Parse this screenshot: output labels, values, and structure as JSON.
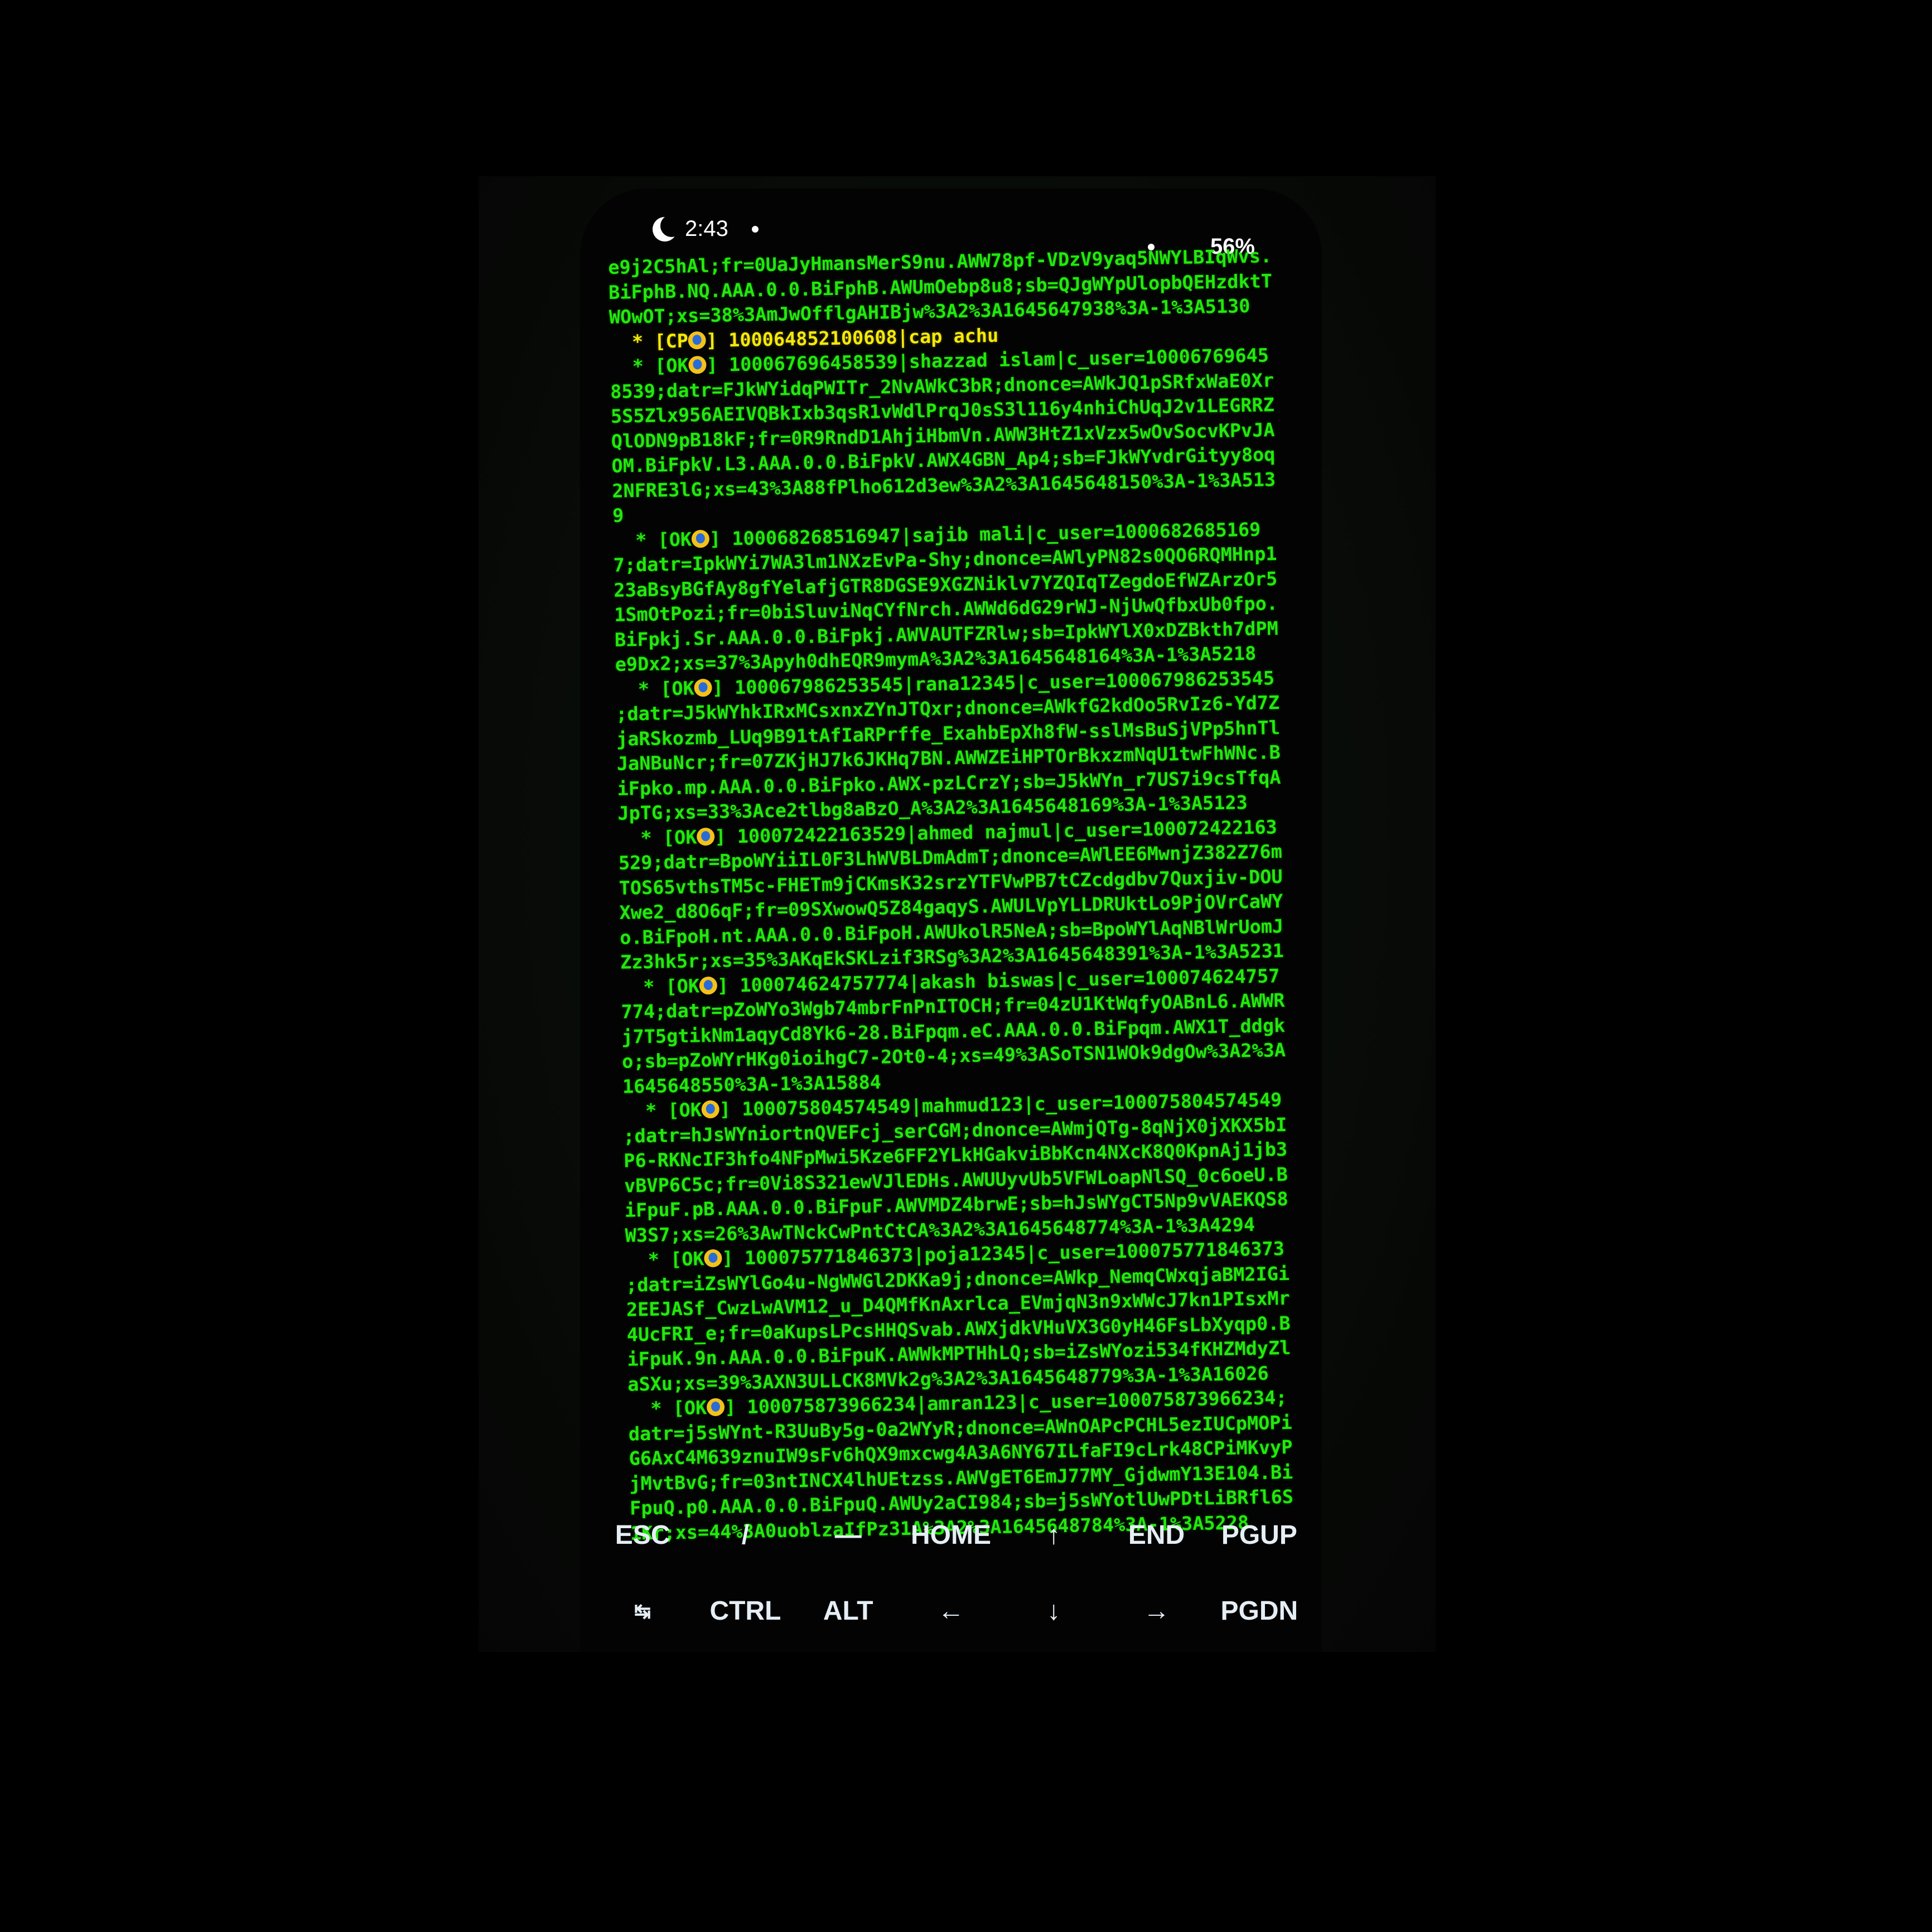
{
  "status_bar": {
    "time": "2:43",
    "battery": "56%"
  },
  "terminal": {
    "lines": [
      {
        "text": "e9j2C5hAl;fr=0UaJyHmansMerS9nu.AWW78pf-VDzV9yaq5NWYLBIqWvs."
      },
      {
        "text": "BiFphB.NQ.AAA.0.0.BiFphB.AWUmOebp8u8;sb=QJgWYpUlopbQEHzdktT"
      },
      {
        "text": "WOwOT;xs=38%3AmJwOfflgAHIBjw%3A2%3A1645647938%3A-1%3A5130"
      },
      {
        "prefix": "  * [CP",
        "suffix": "] ",
        "rest": "100064852100608|cap achu",
        "cp": true
      },
      {
        "prefix": "  * [OK",
        "suffix": "] ",
        "rest": "100067696458539|shazzad islam|c_user=10006769645"
      },
      {
        "text": "8539;datr=FJkWYidqPWITr_2NvAWkC3bR;dnonce=AWkJQ1pSRfxWaE0Xr"
      },
      {
        "text": "5S5Zlx956AEIVQBkIxb3qsR1vWdlPrqJ0sS3l116y4nhiChUqJ2v1LEGRRZ"
      },
      {
        "text": "QlODN9pB18kF;fr=0R9RndD1AhjiHbmVn.AWW3HtZ1xVzx5wOvSocvKPvJA"
      },
      {
        "text": "OM.BiFpkV.L3.AAA.0.0.BiFpkV.AWX4GBN_Ap4;sb=FJkWYvdrGityy8oq"
      },
      {
        "text": "2NFRE3lG;xs=43%3A88fPlho612d3ew%3A2%3A1645648150%3A-1%3A513"
      },
      {
        "text": "9"
      },
      {
        "prefix": "  * [OK",
        "suffix": "] ",
        "rest": "100068268516947|sajib mali|c_user=1000682685169"
      },
      {
        "text": "7;datr=IpkWYi7WA3lm1NXzEvPa-Shy;dnonce=AWlyPN82s0QO6RQMHnp1"
      },
      {
        "text": "23aBsyBGfAy8gfYelafjGTR8DGSE9XGZNiklv7YZQIqTZegdoEfWZArzOr5"
      },
      {
        "text": "1SmOtPozi;fr=0biSluviNqCYfNrch.AWWd6dG29rWJ-NjUwQfbxUb0fpo."
      },
      {
        "text": "BiFpkj.Sr.AAA.0.0.BiFpkj.AWVAUTFZRlw;sb=IpkWYlX0xDZBkth7dPM"
      },
      {
        "text": "e9Dx2;xs=37%3Apyh0dhEQR9mymA%3A2%3A1645648164%3A-1%3A5218"
      },
      {
        "prefix": "  * [OK",
        "suffix": "] ",
        "rest": "100067986253545|rana12345|c_user=100067986253545"
      },
      {
        "text": ";datr=J5kWYhkIRxMCsxnxZYnJTQxr;dnonce=AWkfG2kdOo5RvIz6-Yd7Z"
      },
      {
        "text": "jaRSkozmb_LUq9B91tAfIaRPrffe_ExahbEpXh8fW-sslMsBuSjVPp5hnTl"
      },
      {
        "text": "JaNBuNcr;fr=07ZKjHJ7k6JKHq7BN.AWWZEiHPTOrBkxzmNqU1twFhWNc.B"
      },
      {
        "text": "iFpko.mp.AAA.0.0.BiFpko.AWX-pzLCrzY;sb=J5kWYn_r7US7i9csTfqA"
      },
      {
        "text": "JpTG;xs=33%3Ace2tlbg8aBzO_A%3A2%3A1645648169%3A-1%3A5123"
      },
      {
        "prefix": "  * [OK",
        "suffix": "] ",
        "rest": "100072422163529|ahmed najmul|c_user=100072422163"
      },
      {
        "text": "529;datr=BpoWYiiIL0F3LhWVBLDmAdmT;dnonce=AWlEE6MwnjZ382Z76m"
      },
      {
        "text": "TOS65vthsTM5c-FHETm9jCKmsK32srzYTFVwPB7tCZcdgdbv7Quxjiv-DOU"
      },
      {
        "text": "Xwe2_d8O6qF;fr=09SXwowQ5Z84gaqyS.AWULVpYLLDRUktLo9PjOVrCaWY"
      },
      {
        "text": "o.BiFpoH.nt.AAA.0.0.BiFpoH.AWUkolR5NeA;sb=BpoWYlAqNBlWrUomJ"
      },
      {
        "text": "Zz3hk5r;xs=35%3AKqEkSKLzif3RSg%3A2%3A1645648391%3A-1%3A5231"
      },
      {
        "prefix": "  * [OK",
        "suffix": "] ",
        "rest": "100074624757774|akash biswas|c_user=100074624757"
      },
      {
        "text": "774;datr=pZoWYo3Wgb74mbrFnPnITOCH;fr=04zU1KtWqfyOABnL6.AWWR"
      },
      {
        "text": "j7T5gtikNm1aqyCd8Yk6-28.BiFpqm.eC.AAA.0.0.BiFpqm.AWX1T_ddgk"
      },
      {
        "text": "o;sb=pZoWYrHKg0ioihgC7-2Ot0-4;xs=49%3ASoTSN1WOk9dgOw%3A2%3A"
      },
      {
        "text": "1645648550%3A-1%3A15884"
      },
      {
        "prefix": "  * [OK",
        "suffix": "] ",
        "rest": "100075804574549|mahmud123|c_user=100075804574549"
      },
      {
        "text": ";datr=hJsWYniortnQVEFcj_serCGM;dnonce=AWmjQTg-8qNjX0jXKX5bI"
      },
      {
        "text": "P6-RKNcIF3hfo4NFpMwi5Kze6FF2YLkHGakviBbKcn4NXcK8Q0KpnAj1jb3"
      },
      {
        "text": "vBVP6C5c;fr=0Vi8S321ewVJlEDHs.AWUUyvUb5VFWLoapNlSQ_0c6oeU.B"
      },
      {
        "text": "iFpuF.pB.AAA.0.0.BiFpuF.AWVMDZ4brwE;sb=hJsWYgCT5Np9vVAEKQS8"
      },
      {
        "text": "W3S7;xs=26%3AwTNckCwPntCtCA%3A2%3A1645648774%3A-1%3A4294"
      },
      {
        "prefix": "  * [OK",
        "suffix": "] ",
        "rest": "100075771846373|poja12345|c_user=100075771846373"
      },
      {
        "text": ";datr=iZsWYlGo4u-NgWWGl2DKKa9j;dnonce=AWkp_NemqCWxqjaBM2IGi"
      },
      {
        "text": "2EEJASf_CwzLwAVM12_u_D4QMfKnAxrlca_EVmjqN3n9xWWcJ7kn1PIsxMr"
      },
      {
        "text": "4UcFRI_e;fr=0aKupsLPcsHHQSvab.AWXjdkVHuVX3G0yH46FsLbXyqp0.B"
      },
      {
        "text": "iFpuK.9n.AAA.0.0.BiFpuK.AWWkMPTHhLQ;sb=iZsWYozi534fKHZMdyZl"
      },
      {
        "text": "aSXu;xs=39%3AXN3ULLCK8MVk2g%3A2%3A1645648779%3A-1%3A16026"
      },
      {
        "prefix": "  * [OK",
        "suffix": "] ",
        "rest": "100075873966234|amran123|c_user=100075873966234;"
      },
      {
        "text": "datr=j5sWYnt-R3UuBy5g-0a2WYyR;dnonce=AWnOAPcPCHL5ezIUCpMOPi"
      },
      {
        "text": "G6AxC4M639znuIW9sFv6hQX9mxcwg4A3A6NY67ILfaFI9cLrk48CPiMKvyP"
      },
      {
        "text": "jMvtBvG;fr=03ntINCX4lhUEtzss.AWVgET6EmJ77MY_GjdwmY13E104.Bi"
      },
      {
        "text": "FpuQ.p0.AAA.0.0.BiFpuQ.AWUy2aCI984;sb=j5sWYotlUwPDtLiBRfl6S"
      },
      {
        "text": "1Kr;xs=44%3A0uoblzaIfPz31A%3A2%3A1645648784%3A-1%3A5228"
      }
    ]
  },
  "extra_keys": {
    "row1": [
      "ESC",
      "/",
      "—",
      "HOME",
      "↑",
      "END",
      "PGUP"
    ],
    "row2": [
      "↹",
      "CTRL",
      "ALT",
      "←",
      "↓",
      "→",
      "PGDN"
    ]
  }
}
